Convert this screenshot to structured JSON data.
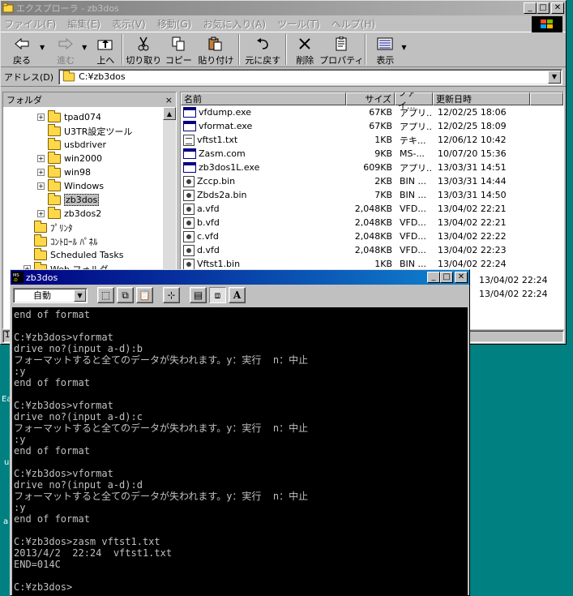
{
  "explorer": {
    "title": "エクスプローラ - zb3dos",
    "menu": [
      "ファイル(F)",
      "編集(E)",
      "表示(V)",
      "移動(G)",
      "お気に入り(A)",
      "ツール(T)",
      "ヘルプ(H)"
    ],
    "toolbar": {
      "back": "戻る",
      "forward": "進む",
      "up": "上へ",
      "cut": "切り取り",
      "copy": "コピー",
      "paste": "貼り付け",
      "undo": "元に戻す",
      "delete": "削除",
      "properties": "プロパティ",
      "views": "表示"
    },
    "address": {
      "label": "アドレス(D)",
      "value": "C:¥zb3dos"
    },
    "tree": {
      "header": "フォルダ",
      "close": "×",
      "items": [
        {
          "label": "tpad074",
          "expand": "+"
        },
        {
          "label": "U3TR設定ツール",
          "expand": ""
        },
        {
          "label": "usbdriver",
          "expand": ""
        },
        {
          "label": "win2000",
          "expand": "+"
        },
        {
          "label": "win98",
          "expand": "+"
        },
        {
          "label": "Windows",
          "expand": "+"
        },
        {
          "label": "zb3dos",
          "expand": ""
        },
        {
          "label": "zb3dos2",
          "expand": "+"
        },
        {
          "label": "ﾌﾟﾘﾝﾀ",
          "expand": ""
        },
        {
          "label": "ｺﾝﾄﾛｰﾙ ﾊﾟﾈﾙ",
          "expand": ""
        },
        {
          "label": "Scheduled Tasks",
          "expand": ""
        },
        {
          "label": "Web フォルダ",
          "expand": "+"
        }
      ]
    },
    "list": {
      "columns": [
        "名前",
        "サイズ",
        "ファイ...",
        "更新日時"
      ],
      "rows": [
        {
          "name": "vfdump.exe",
          "size": "67KB",
          "type": "アプリ...",
          "date": "12/02/25 18:06",
          "icon": "exe"
        },
        {
          "name": "vformat.exe",
          "size": "67KB",
          "type": "アプリ...",
          "date": "12/02/25 18:09",
          "icon": "exe"
        },
        {
          "name": "vftst1.txt",
          "size": "1KB",
          "type": "テキ...",
          "date": "12/06/12 10:42",
          "icon": "doc"
        },
        {
          "name": "Zasm.com",
          "size": "9KB",
          "type": "MS-...",
          "date": "10/07/20 15:36",
          "icon": "exe"
        },
        {
          "name": "zb3dos1L.exe",
          "size": "609KB",
          "type": "アプリ...",
          "date": "13/03/31 14:51",
          "icon": "exe"
        },
        {
          "name": "Zccp.bin",
          "size": "2KB",
          "type": "BIN ...",
          "date": "13/03/31 14:44",
          "icon": "bin"
        },
        {
          "name": "Zbds2a.bin",
          "size": "7KB",
          "type": "BIN ...",
          "date": "13/03/31 14:50",
          "icon": "bin"
        },
        {
          "name": "a.vfd",
          "size": "2,048KB",
          "type": "VFD...",
          "date": "13/04/02 22:21",
          "icon": "bin"
        },
        {
          "name": "b.vfd",
          "size": "2,048KB",
          "type": "VFD...",
          "date": "13/04/02 22:21",
          "icon": "bin"
        },
        {
          "name": "c.vfd",
          "size": "2,048KB",
          "type": "VFD...",
          "date": "13/04/02 22:22",
          "icon": "bin"
        },
        {
          "name": "d.vfd",
          "size": "2,048KB",
          "type": "VFD...",
          "date": "13/04/02 22:23",
          "icon": "bin"
        },
        {
          "name": "Vftst1.bin",
          "size": "1KB",
          "type": "BIN ...",
          "date": "13/04/02 22:24",
          "icon": "bin"
        }
      ],
      "peek_dates": [
        "13/04/02 22:24",
        "13/04/02 22:24"
      ]
    },
    "status": "1"
  },
  "desktop": {
    "labels": [
      "Ea",
      "u",
      "a"
    ]
  },
  "console": {
    "title": "zb3dos",
    "font_size": "自動",
    "lines": [
      "end of format",
      "",
      "C:¥zb3dos>vformat",
      "drive no?(input a-d):b",
      "フォーマットすると全てのデータが失われます。y：実行  n：中止",
      ":y",
      "end of format",
      "",
      "C:¥zb3dos>vformat",
      "drive no?(input a-d):c",
      "フォーマットすると全てのデータが失われます。y：実行  n：中止",
      ":y",
      "end of format",
      "",
      "C:¥zb3dos>vformat",
      "drive no?(input a-d):d",
      "フォーマットすると全てのデータが失われます。y：実行  n：中止",
      ":y",
      "end of format",
      "",
      "C:¥zb3dos>zasm vftst1.txt",
      "2013/4/2  22:24  vftst1.txt",
      "END=014C",
      "",
      "C:¥zb3dos>"
    ]
  }
}
